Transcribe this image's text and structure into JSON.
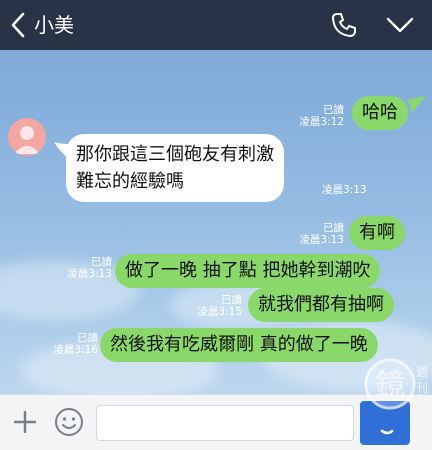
{
  "header": {
    "contact_name": "小美",
    "icons": [
      "back-arrow-icon",
      "phone-icon",
      "chevron-down-icon"
    ]
  },
  "messages": [
    {
      "side": "right",
      "text": "哈哈",
      "read": "已讀",
      "time": "凌晨3:12"
    },
    {
      "side": "left",
      "lines": [
        "那你跟這三個砲友有刺激",
        "難忘的經驗嗎"
      ],
      "time": "凌晨3:13"
    },
    {
      "side": "right",
      "text": "有啊",
      "read": "已讀",
      "time": "凌晨3:13"
    },
    {
      "side": "right",
      "text": "做了一晚 抽了點 把她幹到潮吹",
      "read": "已讀",
      "time": "凌晨3:13"
    },
    {
      "side": "right",
      "text": "就我們都有抽啊",
      "read": "已讀",
      "time": "凌晨3:15"
    },
    {
      "side": "right",
      "text": "然後我有吃威爾剛 真的做了一晚",
      "read": "已讀",
      "time": "凌晨3:16"
    }
  ],
  "input": {
    "placeholder": "",
    "value": ""
  },
  "watermark": {
    "text": "鏡",
    "small": [
      "週",
      "刊"
    ]
  },
  "colors": {
    "header": "#283347",
    "green_bubble": "#8bd86a",
    "white_bubble": "#ffffff",
    "send": "#2f6fd6"
  }
}
